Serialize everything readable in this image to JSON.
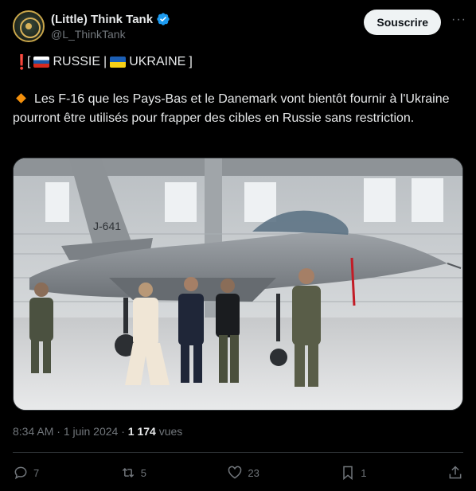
{
  "account": {
    "display_name": "(Little) Think Tank",
    "handle": "@L_ThinkTank",
    "verified": true
  },
  "header": {
    "subscribe_label": "Souscrire",
    "more_label": "···"
  },
  "tweet": {
    "tag_excl": "❗",
    "tag_open": "[",
    "tag_russia": "RUSSIE",
    "tag_sep": "|",
    "tag_ukraine": "UKRAINE",
    "tag_close": "]",
    "body": "Les F-16 que les Pays-Bas et le Danemark vont bientôt fournir à l'Ukraine pourront être utilisés pour frapper des cibles en Russie sans restriction.",
    "image_tail_code": "J-641"
  },
  "meta": {
    "time": "8:34 AM",
    "separator": " · ",
    "date": "1 juin 2024",
    "views_count": "1 174",
    "views_label": "vues"
  },
  "actions": {
    "replies": "7",
    "reposts": "5",
    "likes": "23",
    "bookmarks": "1"
  },
  "colors": {
    "background": "#000000",
    "text": "#e7e9ea",
    "muted": "#71767b",
    "verified": "#1d9bf0",
    "diamond": "#f4900c"
  }
}
